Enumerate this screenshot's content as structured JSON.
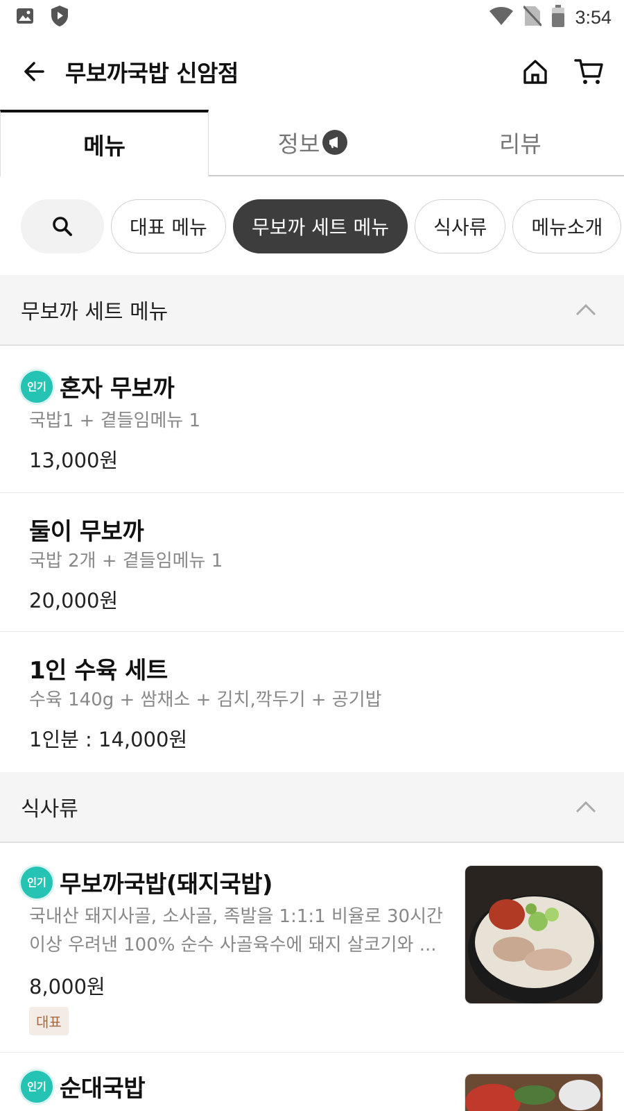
{
  "status_bar": {
    "time": "3:54"
  },
  "header": {
    "title": "무보까국밥 신암점"
  },
  "tabs": [
    {
      "label": "메뉴"
    },
    {
      "label": "정보"
    },
    {
      "label": "리뷰"
    }
  ],
  "chips": [
    {
      "label": "대표 메뉴"
    },
    {
      "label": "무보까 세트 메뉴"
    },
    {
      "label": "식사류"
    },
    {
      "label": "메뉴소개"
    }
  ],
  "sections": [
    {
      "title": "무보까 세트 메뉴",
      "items": [
        {
          "badge": "인기",
          "name": "혼자 무보까",
          "desc": "국밥1 + 곁들임메뉴 1",
          "price": "13,000원"
        },
        {
          "name": "둘이 무보까",
          "desc": "국밥 2개 + 곁들임메뉴 1",
          "price": "20,000원"
        },
        {
          "name": "1인 수육 세트",
          "desc": "수육 140g + 쌈채소 + 김치,깍두기 + 공기밥",
          "price": "1인분 : 14,000원"
        }
      ]
    },
    {
      "title": "식사류",
      "items": [
        {
          "badge": "인기",
          "name": "무보까국밥(돼지국밥)",
          "desc_line1": "국내산 돼지사골, 소사골, 족발을 1:1:1 비율로 30시간",
          "desc_line2": "이상 우려낸 100% 순수 사골육수에 돼지 살코기와 ...",
          "price": "8,000원",
          "tag": "대표"
        },
        {
          "badge": "인기",
          "name": "순대국밥"
        }
      ]
    }
  ],
  "colors": {
    "popular_badge": "#25c3b4",
    "active_chip": "#3d3d3d",
    "tag_text": "#a8673e"
  }
}
